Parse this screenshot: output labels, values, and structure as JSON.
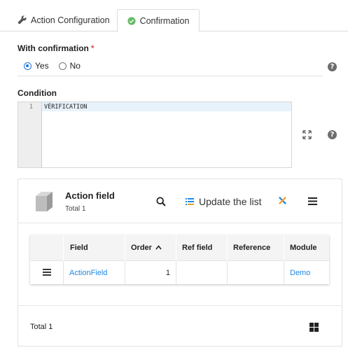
{
  "tabs": [
    {
      "label": "Action Configuration",
      "icon": "wrench-icon"
    },
    {
      "label": "Confirmation",
      "icon": "check-circle-icon",
      "active": true
    }
  ],
  "confirmation": {
    "label": "With confirmation",
    "required_mark": "*",
    "options": [
      "Yes",
      "No"
    ],
    "selected": "Yes"
  },
  "condition": {
    "label": "Condition",
    "line_number": "1",
    "code": "VÉRIFICATION"
  },
  "help_glyph": "?",
  "panel": {
    "title": "Action field",
    "total": "Total 1",
    "update_label": "Update the list",
    "columns": [
      "",
      "Field",
      "Order",
      "Ref field",
      "Reference",
      "Module"
    ],
    "rows": [
      {
        "field": "ActionField",
        "order": "1",
        "ref_field": "",
        "reference": "",
        "module": "Demo"
      }
    ],
    "footer_total": "Total 1"
  },
  "colors": {
    "accent": "#1e88e5",
    "required": "#d9534f",
    "radio": "#1e73d8"
  }
}
